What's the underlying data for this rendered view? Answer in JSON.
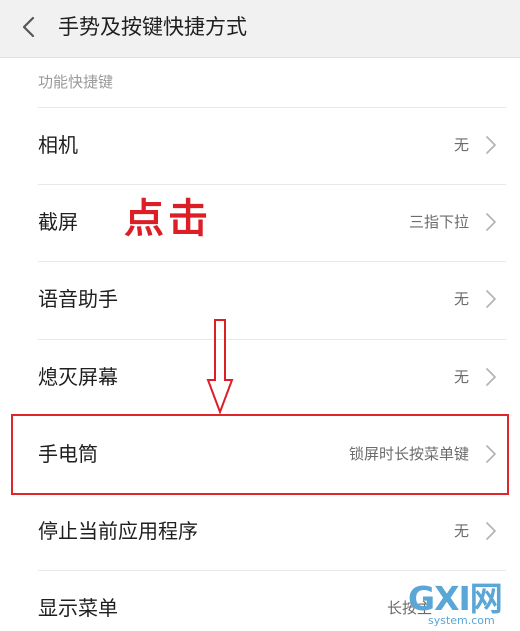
{
  "header": {
    "back_icon": "chevron-left-icon",
    "title": "手势及按键快捷方式"
  },
  "section": {
    "label": "功能快捷键"
  },
  "rows": [
    {
      "label": "相机",
      "value": "无"
    },
    {
      "label": "截屏",
      "value": "三指下拉"
    },
    {
      "label": "语音助手",
      "value": "无"
    },
    {
      "label": "熄灭屏幕",
      "value": "无"
    },
    {
      "label": "手电筒",
      "value": "锁屏时长按菜单键"
    },
    {
      "label": "停止当前应用程序",
      "value": "无"
    },
    {
      "label": "显示菜单",
      "value": "长按主"
    }
  ],
  "annotation": {
    "text": "点击",
    "color": "#dc1f26",
    "arrow_icon": "down-arrow-icon",
    "highlight_color": "#e0262c"
  },
  "watermark": {
    "brand": "GXI网",
    "domain": "system.com",
    "color": "#5aa6d6"
  },
  "colors": {
    "header_bg": "#f1f1f1",
    "text_primary": "#1f1f1f",
    "text_secondary": "#6b6b6b",
    "section_label": "#9a9a9a",
    "divider": "#e8e8e8"
  }
}
